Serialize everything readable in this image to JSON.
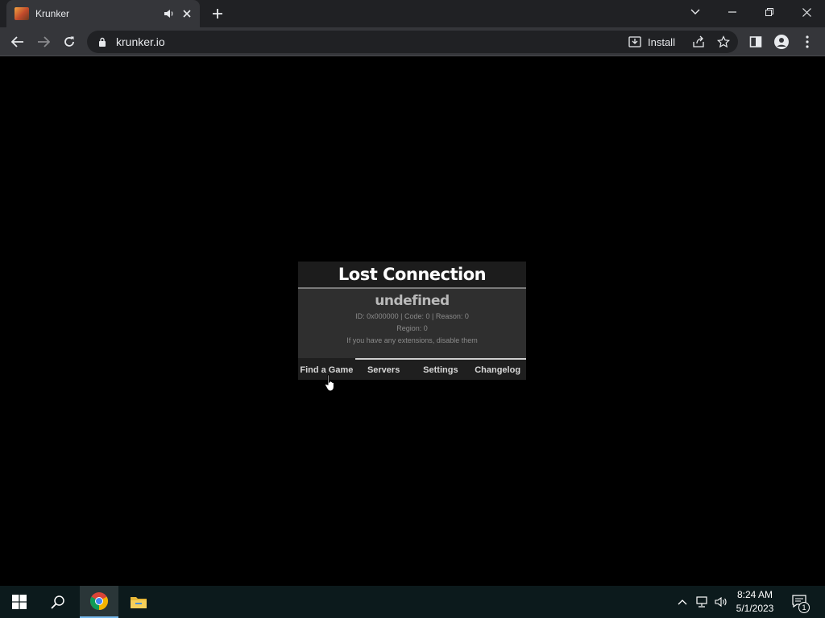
{
  "browser": {
    "tab": {
      "title": "Krunker",
      "favicon": "krunker-favicon",
      "audio_icon": "speaker-icon",
      "close_icon": "close-icon"
    },
    "new_tab_icon": "plus-icon",
    "window_controls": [
      "chevron-down-icon",
      "minimize-icon",
      "restore-icon",
      "close-icon"
    ],
    "toolbar": {
      "back_icon": "arrow-left-icon",
      "forward_icon": "arrow-right-icon",
      "reload_icon": "reload-icon",
      "url": "krunker.io",
      "install_label": "Install",
      "share_icon": "share-icon",
      "bookmark_icon": "star-icon",
      "side_panel_icon": "side-panel-icon",
      "profile_icon": "person-icon",
      "menu_icon": "kebab-menu-icon"
    }
  },
  "dialog": {
    "title": "Lost Connection",
    "reason": "undefined",
    "details": "ID: 0x000000 | Code: 0 | Reason: 0",
    "region": "Region: 0",
    "hint": "If you have any extensions, disable them",
    "nav": [
      "Find a Game",
      "Servers",
      "Settings",
      "Changelog"
    ]
  },
  "taskbar": {
    "start_icon": "windows-icon",
    "search_icon": "search-icon",
    "apps": [
      "chrome-icon",
      "file-explorer-icon"
    ],
    "tray_icons": [
      "chevron-up-icon",
      "network-icon",
      "volume-icon"
    ],
    "time": "8:24 AM",
    "date": "5/1/2023",
    "notification_count": "1"
  },
  "colors": {
    "accent": "#76b9ed",
    "page_bg": "#000000",
    "chrome_bg": "#35363a"
  }
}
